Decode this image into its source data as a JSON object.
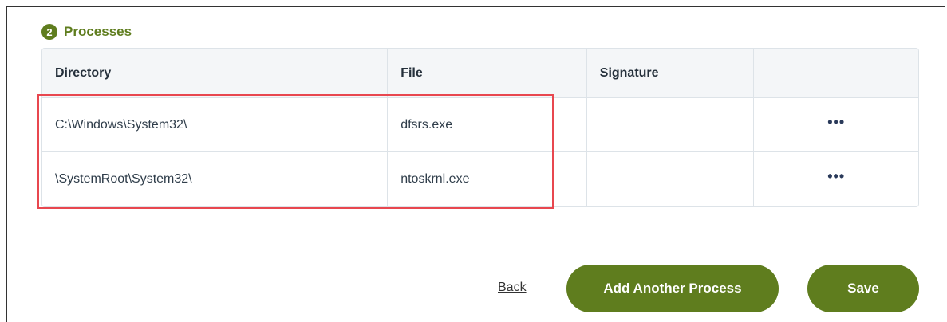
{
  "section": {
    "step_number": "2",
    "title": "Processes"
  },
  "table": {
    "headers": [
      "Directory",
      "File",
      "Signature",
      ""
    ],
    "rows": [
      {
        "directory": "C:\\Windows\\System32\\",
        "file": "dfsrs.exe",
        "signature": "",
        "actions": "•••"
      },
      {
        "directory": "\\SystemRoot\\System32\\",
        "file": "ntoskrnl.exe",
        "signature": "",
        "actions": "•••"
      }
    ]
  },
  "footer": {
    "back_label": "Back",
    "add_label": "Add Another Process",
    "save_label": "Save"
  },
  "colors": {
    "accent": "#5f7d1e",
    "highlight": "#e8474f"
  }
}
